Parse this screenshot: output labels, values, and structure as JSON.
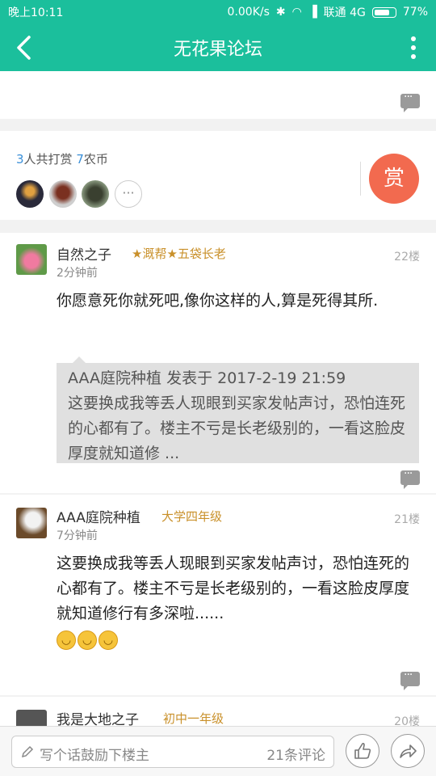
{
  "status_bar": {
    "time": "晚上10:11",
    "speed": "0.00K/s",
    "carrier": "联通 4G",
    "battery": "77%",
    "battery_level": 0.77
  },
  "app_bar": {
    "title": "无花果论坛",
    "back_icon": "back-arrow-icon",
    "menu_icon": "more-vert-icon"
  },
  "reward": {
    "count": "3",
    "count_suffix": "人共打赏",
    "coins": "7",
    "coins_suffix": "农币",
    "more": "···",
    "button_label": "赏"
  },
  "posts": [
    {
      "username": "自然之子",
      "badge": "★溉帮★五袋长老",
      "time": "2分钟前",
      "floor": "22楼",
      "content": "你愿意死你就死吧,像你这样的人,算是死得其所.",
      "quote": {
        "header": "AAA庭院种植 发表于 2017-2-19 21:59",
        "body": "这要换成我等丢人现眼到买家发帖声讨，恐怕连死的心都有了。楼主不亏是长老级别的，一看这脸皮厚度就知道修 ..."
      }
    },
    {
      "username": "AAA庭院种植",
      "badge": "大学四年级",
      "time": "7分钟前",
      "floor": "21楼",
      "content": "这要换成我等丢人现眼到买家发帖声讨，恐怕连死的心都有了。楼主不亏是长老级别的，一看这脸皮厚度就知道修行有多深啦......",
      "emoji_count": 3
    },
    {
      "username": "我是大地之子",
      "badge": "初中一年级",
      "floor": "20楼"
    }
  ],
  "bottom_bar": {
    "placeholder": "写个话鼓励下楼主",
    "comment_count": "21条评论",
    "like_icon": "thumbs-up-icon",
    "share_icon": "share-icon"
  },
  "colors": {
    "primary": "#1bbf9c",
    "reward": "#f26a4f",
    "badge": "#c9902a",
    "number": "#3a8fd8"
  }
}
